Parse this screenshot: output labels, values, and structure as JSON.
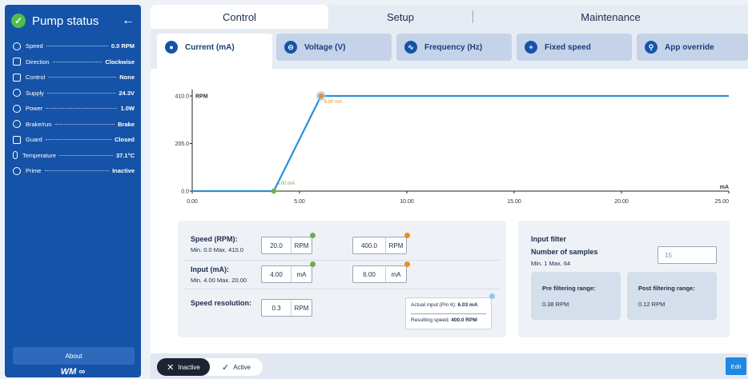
{
  "sidebar": {
    "title": "Pump status",
    "items": [
      {
        "label": "Speed",
        "value": "0.0 RPM",
        "icon": "speed-icon"
      },
      {
        "label": "Direction",
        "value": "Clockwise",
        "icon": "direction-icon"
      },
      {
        "label": "Control",
        "value": "None",
        "icon": "control-icon"
      },
      {
        "label": "Supply",
        "value": "24.3V",
        "icon": "supply-icon"
      },
      {
        "label": "Power",
        "value": "1.0W",
        "icon": "power-icon"
      },
      {
        "label": "Brake/run",
        "value": "Brake",
        "icon": "brake-icon"
      },
      {
        "label": "Guard",
        "value": "Closed",
        "icon": "guard-icon"
      },
      {
        "label": "Temperature",
        "value": "37.1°C",
        "icon": "temperature-icon"
      },
      {
        "label": "Prime",
        "value": "Inactive",
        "icon": "prime-icon"
      }
    ],
    "about_label": "About",
    "logo_text": "WM"
  },
  "top_tabs": [
    "Control",
    "Setup",
    "Maintenance"
  ],
  "mode_tabs": [
    "Current (mA)",
    "Voltage (V)",
    "Frequency (Hz)",
    "Fixed speed",
    "App override"
  ],
  "chart_data": {
    "type": "line",
    "x": [
      0.0,
      3.8,
      6.0,
      25.0
    ],
    "y": [
      0.0,
      0.0,
      410.0,
      410.0
    ],
    "xlim": [
      0,
      25
    ],
    "ylim": [
      0,
      410
    ],
    "x_ticks": [
      "0.00",
      "5.00",
      "10.00",
      "15.00",
      "20.00",
      "25.00"
    ],
    "y_ticks": [
      "0.0",
      "205.0",
      "410.0"
    ],
    "ylabel": "RPM",
    "xlabel": "mA",
    "annotations": [
      {
        "x": 3.8,
        "y": 0.0,
        "label": "4.00 mA",
        "color": "#6ab04c"
      },
      {
        "x": 6.0,
        "y": 410.0,
        "label": "6.00 mA",
        "color": "#f08a24"
      }
    ],
    "line_color": "#2d8fd8",
    "grid": false
  },
  "settings": {
    "speed_label": "Speed (RPM):",
    "speed_range": "Min. 0.0 Max. 410.0",
    "speed_min_value": "20.0",
    "speed_max_value": "400.0",
    "speed_unit": "RPM",
    "input_label": "Input (mA):",
    "input_range": "Min. 4.00 Max. 20.00",
    "input_min_value": "4.00",
    "input_max_value": "6.00",
    "input_unit": "mA",
    "resolution_label": "Speed resolution:",
    "resolution_value": "0.3",
    "resolution_unit": "RPM",
    "actual_input_label": "Actual input (Pin 6):",
    "actual_input_value": "6.03 mA",
    "resulting_speed_label": "Resulting speed:",
    "resulting_speed_value": "400.0 RPM"
  },
  "input_filter": {
    "title": "Input filter",
    "samples_label": "Number of samples",
    "samples_range": "Min. 1 Max. 64",
    "samples_value": "15",
    "pre_label": "Pre filtering range:",
    "pre_value": "0.38 RPM",
    "post_label": "Post filtering range:",
    "post_value": "0.12 RPM"
  },
  "bottom": {
    "inactive_label": "Inactive",
    "active_label": "Active",
    "edit_label": "Edit"
  },
  "colors": {
    "sidebar_bg": "#1553a8",
    "accent": "#1e88e5",
    "green": "#6ab04c",
    "orange": "#f08a24"
  }
}
